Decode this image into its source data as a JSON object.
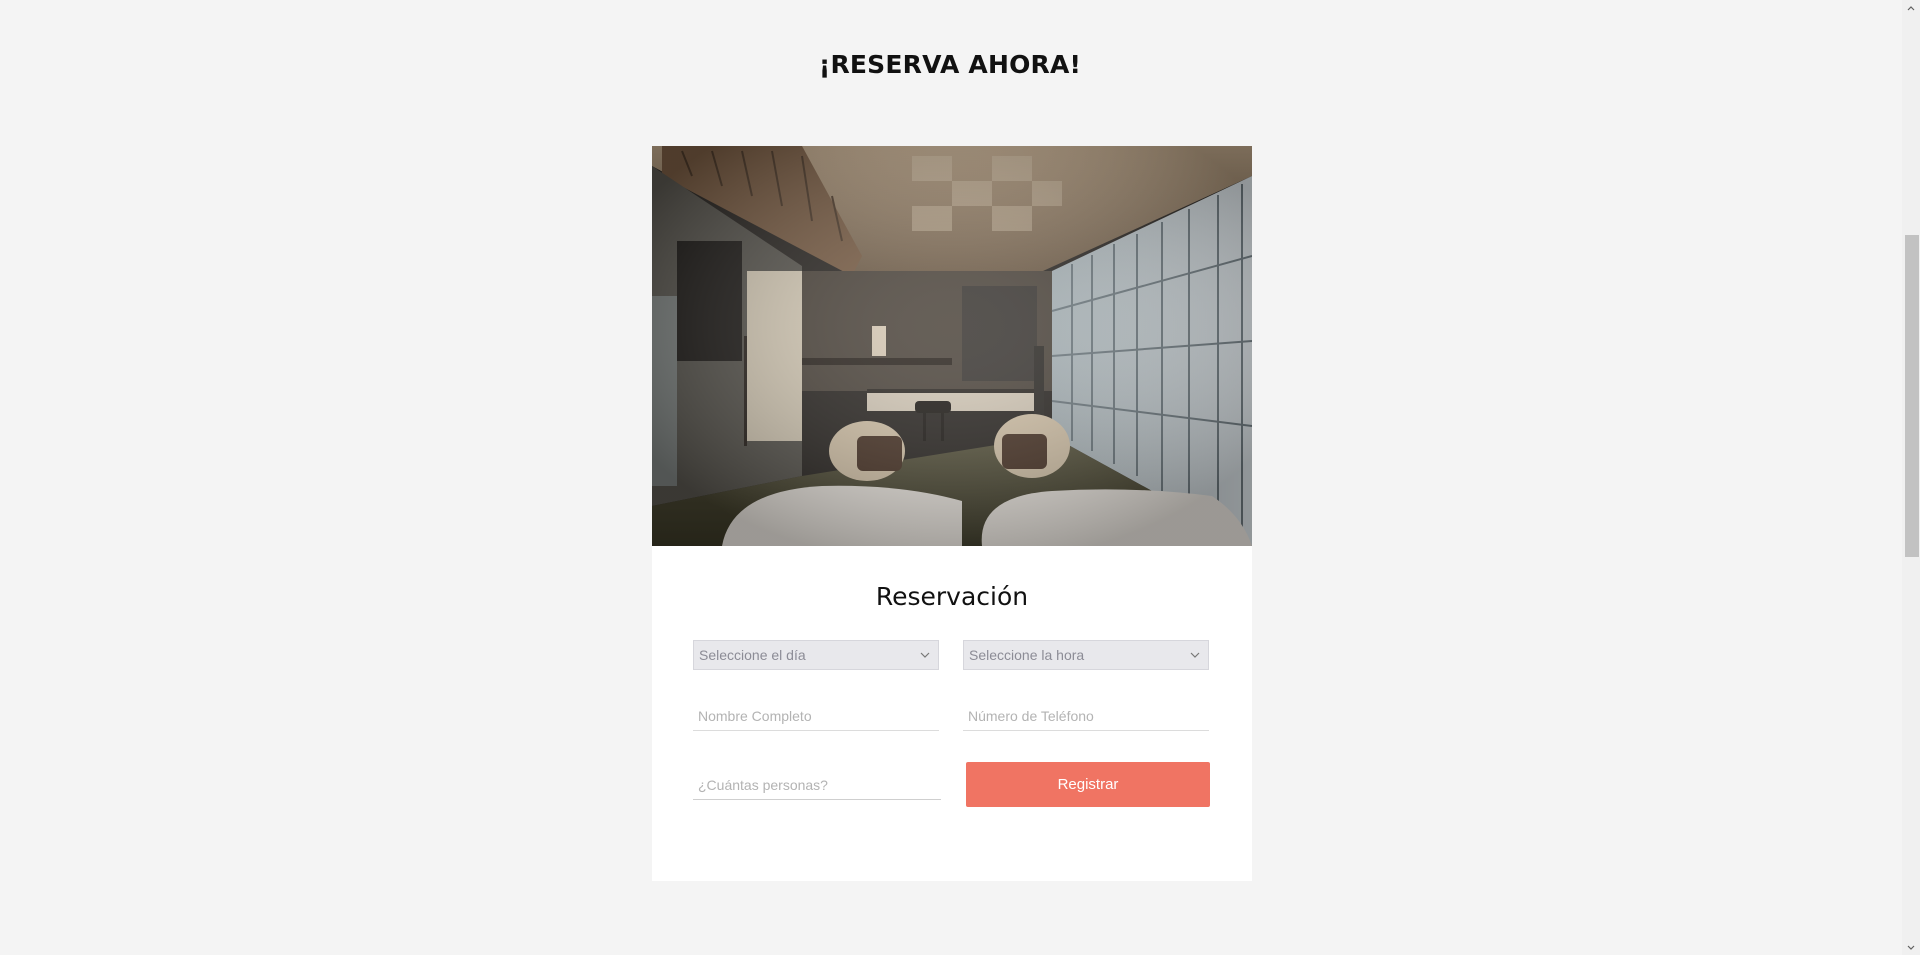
{
  "page": {
    "heading": "¡RESERVA AHORA!"
  },
  "reservation": {
    "image_alt": "Habitación de hotel estilo japonés",
    "title": "Reservación",
    "day_select": {
      "label": "Seleccione el día",
      "icon": "chevron-down-icon"
    },
    "hour_select": {
      "label": "Seleccione la hora",
      "icon": "chevron-down-icon"
    },
    "name_field": {
      "placeholder": "Nombre Completo",
      "value": ""
    },
    "phone_field": {
      "placeholder": "Número de Teléfono",
      "value": ""
    },
    "people_field": {
      "placeholder": "¿Cuántas personas?",
      "value": ""
    },
    "submit_label": "Registrar"
  },
  "colors": {
    "page_background": "#f4f4f4",
    "card_background": "#ffffff",
    "button": "#f07463",
    "select_background": "#e8e8ec"
  },
  "scrollbar": {
    "up_icon": "scroll-up-arrow-icon",
    "down_icon": "scroll-down-arrow-icon"
  }
}
